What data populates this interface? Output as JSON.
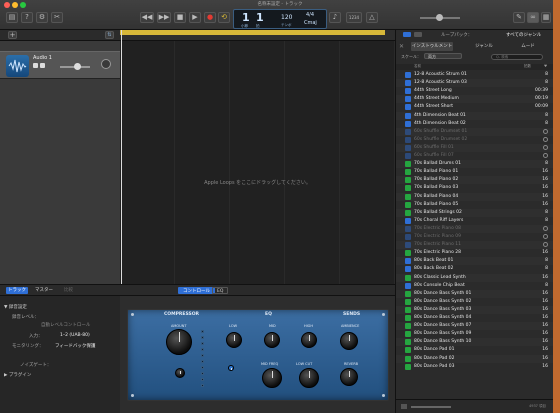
{
  "window": {
    "title": "名称未設定 - トラック"
  },
  "colors": {
    "accent_yellow": "#d6b739",
    "loop_blue": "#2f6fd6",
    "loop_green": "#25a640",
    "record_red": "#e33b33",
    "lcd_bg": "#14191e"
  },
  "toolbar": {
    "left_icons": [
      "library-icon",
      "help-icon",
      "smart-controls-icon",
      "editors-icon"
    ],
    "transport": [
      "rewind-icon",
      "fast-forward-icon",
      "stop-icon",
      "play-icon",
      "record-icon",
      "cycle-icon"
    ],
    "lcd": {
      "bar": "1",
      "beat": "1",
      "bar_label": "小節",
      "beat_label": "拍",
      "tempo": "120",
      "tempo_label": "テンポ",
      "time_sig": "4/4",
      "key": "Cmaj"
    },
    "tuner_icon": "tuner-icon",
    "count_in": "1234",
    "right_icons": [
      "notepad-icon",
      "loop-browser-icon",
      "media-browser-icon"
    ]
  },
  "tracks": {
    "add_label": "+",
    "filter_label": "⇅",
    "items": [
      {
        "name": "Audio 1"
      }
    ]
  },
  "arrange": {
    "drop_hint": "Apple Loops をここにドラッグしてください。"
  },
  "editor": {
    "tabs": {
      "track": "トラック",
      "master": "マスター",
      "compare": "比較"
    },
    "right_tabs": {
      "controls": "コントロール",
      "eq": "EQ"
    },
    "left_rows": {
      "section_recording": "▼ 録音設定",
      "recording_level": "録音レベル：",
      "auto_level": "自動レベルコントロール",
      "input_label": "入力：",
      "input_value": "1–2 (UAB-80)",
      "monitoring": "モニタリング：",
      "feedback": "フィードバック保護",
      "noise_gate": "ノイズゲート：",
      "plugins": "▶ プラグイン"
    },
    "rack": {
      "compressor": "COMPRESSOR",
      "amount": "AMOUNT",
      "eq": "EQ",
      "low": "LOW",
      "mid": "MID",
      "high": "HIGH",
      "mid_freq": "MID FREQ",
      "low_cut": "LOW CUT",
      "sends": "SENDS",
      "ambience": "AMBIENCE",
      "reverb": "REVERB"
    }
  },
  "library": {
    "tabs": {
      "loops": "ループパック：",
      "packs": "すべてのジャンル"
    },
    "filters": [
      "インストゥルメント",
      "ジャンル",
      "ムード"
    ],
    "scale_label": "スケール：",
    "scale_value": "両方",
    "search_placeholder": "Q- 検索",
    "columns": {
      "name": "名前",
      "beats": "拍数",
      "fav": "♥"
    },
    "loops": [
      {
        "name": "12-8 Acoustic Strum 01",
        "beats": "8",
        "icon": "blue",
        "dim": false,
        "dl": false
      },
      {
        "name": "12-8 Acoustic Strum 03",
        "beats": "8",
        "icon": "blue",
        "dim": false,
        "dl": false
      },
      {
        "name": "44th Street Long",
        "beats": "00:39",
        "icon": "blue",
        "dim": false,
        "dl": false
      },
      {
        "name": "44th Street Medium",
        "beats": "00:19",
        "icon": "blue",
        "dim": false,
        "dl": false
      },
      {
        "name": "44th Street Short",
        "beats": "00:09",
        "icon": "blue",
        "dim": false,
        "dl": false
      },
      {
        "name": "4th Dimension Beat 01",
        "beats": "8",
        "icon": "blue",
        "dim": false,
        "dl": false
      },
      {
        "name": "4th Dimension Beat 02",
        "beats": "8",
        "icon": "blue",
        "dim": false,
        "dl": false
      },
      {
        "name": "60s Shuffle Drumset 01",
        "beats": "",
        "icon": "blue",
        "dim": true,
        "dl": true
      },
      {
        "name": "60s Shuffle Drumset 02",
        "beats": "",
        "icon": "blue",
        "dim": true,
        "dl": true
      },
      {
        "name": "60s Shuffle Fill 01",
        "beats": "",
        "icon": "blue",
        "dim": true,
        "dl": true
      },
      {
        "name": "60s Shuffle Fill 07",
        "beats": "",
        "icon": "blue",
        "dim": true,
        "dl": true
      },
      {
        "name": "70s Ballad Drums 01",
        "beats": "8",
        "icon": "green",
        "dim": false,
        "dl": false
      },
      {
        "name": "70s Ballad Piano 01",
        "beats": "16",
        "icon": "green",
        "dim": false,
        "dl": false
      },
      {
        "name": "70s Ballad Piano 02",
        "beats": "16",
        "icon": "green",
        "dim": false,
        "dl": false
      },
      {
        "name": "70s Ballad Piano 03",
        "beats": "16",
        "icon": "green",
        "dim": false,
        "dl": false
      },
      {
        "name": "70s Ballad Piano 04",
        "beats": "16",
        "icon": "green",
        "dim": false,
        "dl": false
      },
      {
        "name": "70s Ballad Piano 05",
        "beats": "16",
        "icon": "green",
        "dim": false,
        "dl": false
      },
      {
        "name": "70s Ballad Strings 02",
        "beats": "8",
        "icon": "green",
        "dim": false,
        "dl": false
      },
      {
        "name": "70s Choral Riff Layers",
        "beats": "8",
        "icon": "blue",
        "dim": false,
        "dl": false
      },
      {
        "name": "70s Electric Piano 08",
        "beats": "",
        "icon": "blue",
        "dim": true,
        "dl": true
      },
      {
        "name": "70s Electric Piano 09",
        "beats": "",
        "icon": "blue",
        "dim": true,
        "dl": true
      },
      {
        "name": "70s Electric Piano 11",
        "beats": "",
        "icon": "blue",
        "dim": true,
        "dl": true
      },
      {
        "name": "70s Electric Piano 28",
        "beats": "16",
        "icon": "green",
        "dim": false,
        "dl": false
      },
      {
        "name": "80s Back Beat 01",
        "beats": "8",
        "icon": "blue",
        "dim": false,
        "dl": false
      },
      {
        "name": "80s Back Beat 02",
        "beats": "8",
        "icon": "blue",
        "dim": false,
        "dl": false
      },
      {
        "name": "80s Classic Lead Synth",
        "beats": "16",
        "icon": "green",
        "dim": false,
        "dl": false
      },
      {
        "name": "80s Console Chip Beat",
        "beats": "8",
        "icon": "blue",
        "dim": false,
        "dl": false
      },
      {
        "name": "80s Dance Bass Synth 01",
        "beats": "16",
        "icon": "green",
        "dim": false,
        "dl": false
      },
      {
        "name": "80s Dance Bass Synth 02",
        "beats": "16",
        "icon": "green",
        "dim": false,
        "dl": false
      },
      {
        "name": "80s Dance Bass Synth 03",
        "beats": "16",
        "icon": "green",
        "dim": false,
        "dl": false
      },
      {
        "name": "80s Dance Bass Synth 04",
        "beats": "16",
        "icon": "green",
        "dim": false,
        "dl": false
      },
      {
        "name": "80s Dance Bass Synth 07",
        "beats": "16",
        "icon": "green",
        "dim": false,
        "dl": false
      },
      {
        "name": "80s Dance Bass Synth 09",
        "beats": "16",
        "icon": "green",
        "dim": false,
        "dl": false
      },
      {
        "name": "80s Dance Bass Synth 10",
        "beats": "16",
        "icon": "green",
        "dim": false,
        "dl": false
      },
      {
        "name": "80s Dance Pad 01",
        "beats": "16",
        "icon": "green",
        "dim": false,
        "dl": false
      },
      {
        "name": "80s Dance Pad 02",
        "beats": "16",
        "icon": "green",
        "dim": false,
        "dl": false
      },
      {
        "name": "80s Dance Pad 03",
        "beats": "16",
        "icon": "green",
        "dim": false,
        "dl": false
      }
    ],
    "footer": {
      "count": "4937 項目"
    }
  }
}
